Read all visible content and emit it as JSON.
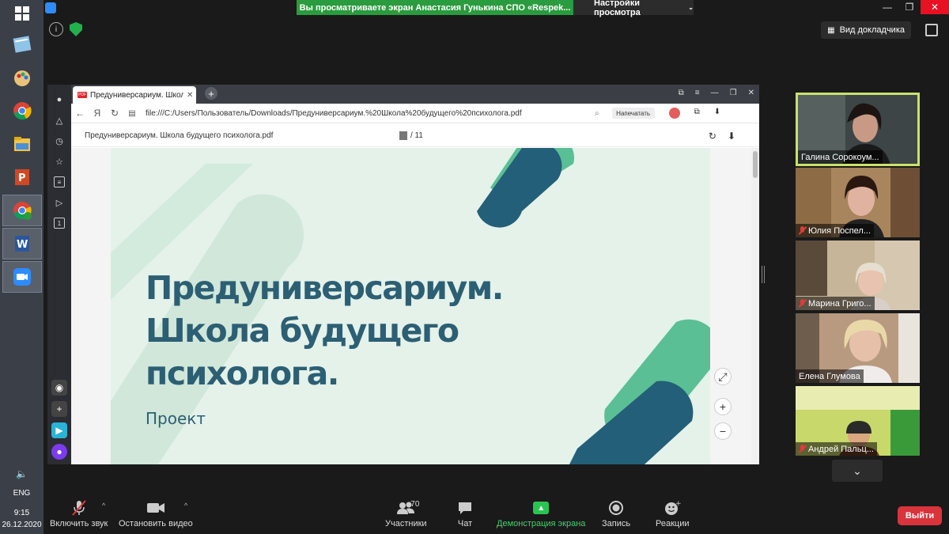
{
  "zoom": {
    "share_banner": "Вы просматриваете экран Анастасия Гунькина СПО «Respek...",
    "view_settings": "Настройки просмотра",
    "speaker_view": "Вид докладчика",
    "window_controls": [
      "—",
      "❐",
      "✕"
    ],
    "participants_count": "70",
    "toolbar": {
      "mute": "Включить звук",
      "video": "Остановить видео",
      "participants": "Участники",
      "chat": "Чат",
      "share": "Демонстрация экрана",
      "record": "Запись",
      "reactions": "Реакции",
      "leave": "Выйти"
    }
  },
  "taskbar": {
    "lang": "ENG",
    "time": "9:15",
    "date": "26.12.2020"
  },
  "browser": {
    "tab_title": "Предуниверсариум. Школа",
    "address": "file:///C:/Users/Пользователь/Downloads/Предуниверсариум.%20Школа%20будущего%20психолога.pdf",
    "print_button": "Напечатать",
    "pdf_name": "Предуниверсариум. Школа будущего психолога.pdf",
    "page_count": "/ 11"
  },
  "slide": {
    "title_lines": [
      "Предуниверсариум.",
      "Школа будущего",
      "психолога."
    ],
    "subtitle": "Проект"
  },
  "participants": [
    {
      "name": "Галина Сорокоум...",
      "muted": false
    },
    {
      "name": "Юлия Поспел...",
      "muted": true
    },
    {
      "name": "Марина Григо...",
      "muted": true
    },
    {
      "name": "Елена Глумова",
      "muted": false
    },
    {
      "name": "Андрей Пальц...",
      "muted": true
    }
  ],
  "colors": {
    "share_banner": "#2a9b3e",
    "slide_text": "#2c5f73",
    "slide_bg": "#e4f2ea",
    "accent_green": "#5bbf95",
    "accent_dark": "#235f78",
    "leave": "#d9343b"
  }
}
